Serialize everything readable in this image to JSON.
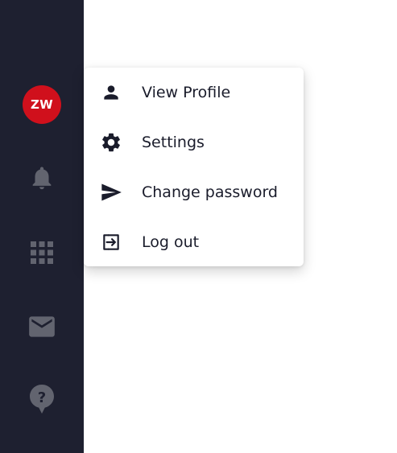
{
  "sidebar": {
    "avatar_initials": "ZW",
    "avatar_color": "#d0101c",
    "background": "#1e2030",
    "icons": [
      {
        "name": "bell-icon"
      },
      {
        "name": "apps-grid-icon"
      },
      {
        "name": "mail-icon"
      },
      {
        "name": "help-icon"
      }
    ]
  },
  "user_menu": {
    "items": [
      {
        "label": "View Profile",
        "icon": "person-icon"
      },
      {
        "label": "Settings",
        "icon": "gear-icon"
      },
      {
        "label": "Change password",
        "icon": "send-icon"
      },
      {
        "label": "Log out",
        "icon": "logout-icon"
      }
    ]
  }
}
